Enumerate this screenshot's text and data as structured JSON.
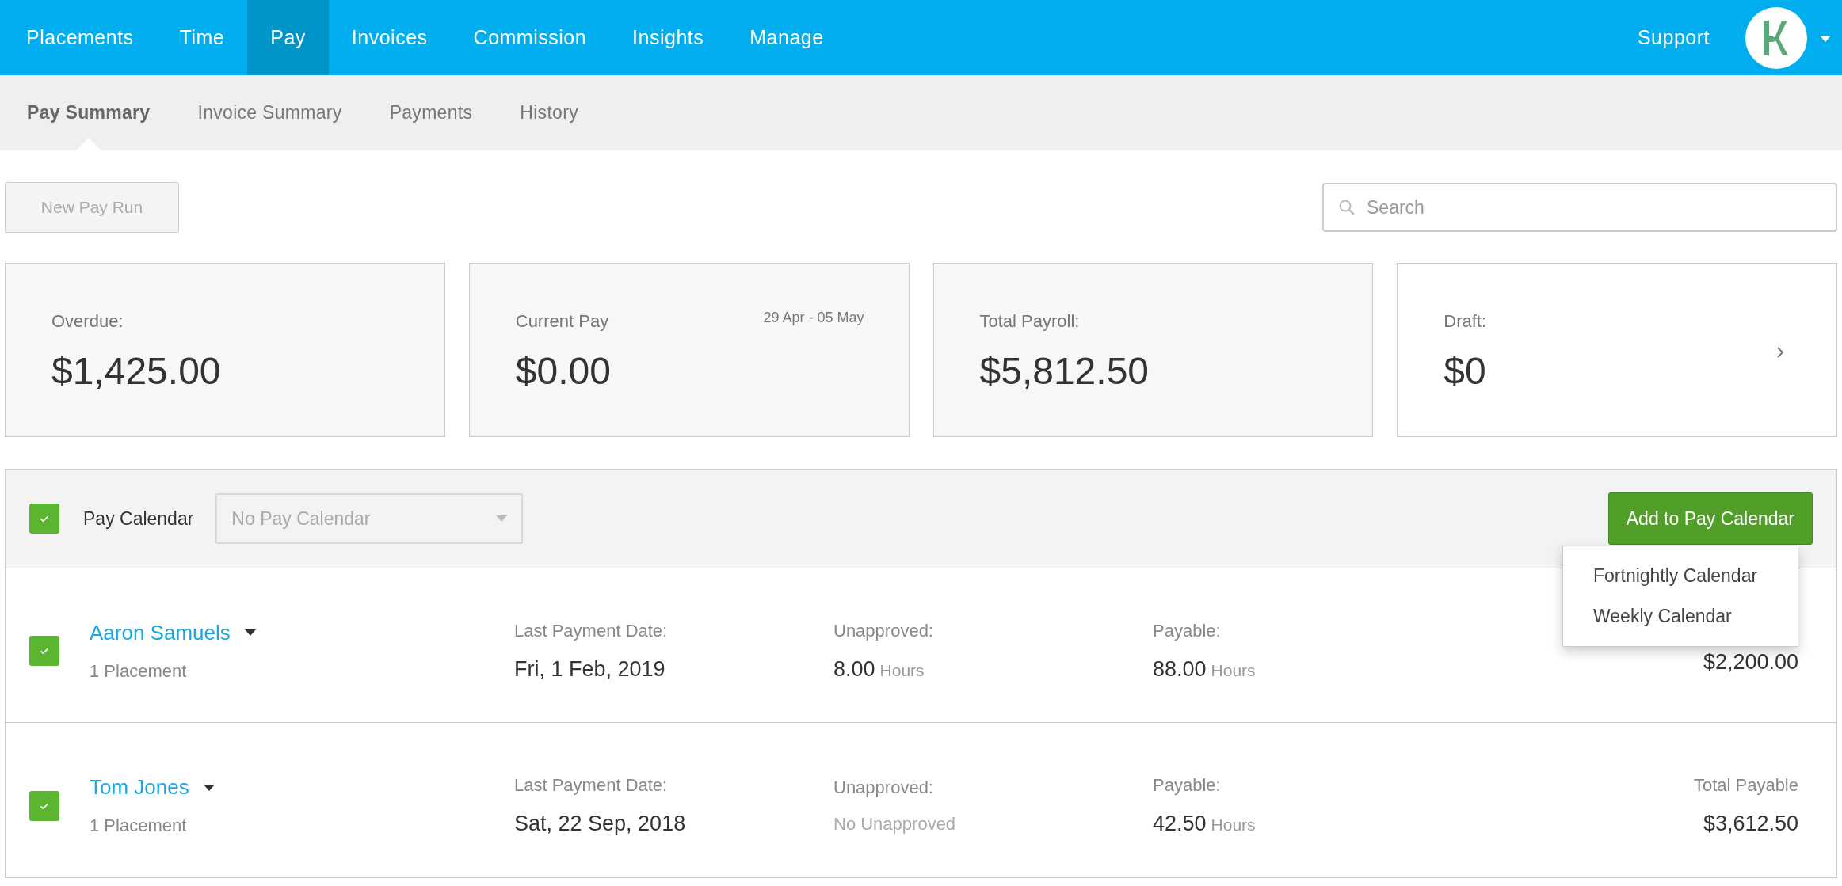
{
  "top_nav": {
    "items": [
      {
        "label": "Placements",
        "selected": false
      },
      {
        "label": "Time",
        "selected": false
      },
      {
        "label": "Pay",
        "selected": true
      },
      {
        "label": "Invoices",
        "selected": false
      },
      {
        "label": "Commission",
        "selected": false
      },
      {
        "label": "Insights",
        "selected": false
      },
      {
        "label": "Manage",
        "selected": false
      }
    ],
    "support": "Support"
  },
  "sub_nav": {
    "tabs": [
      {
        "label": "Pay Summary",
        "selected": true
      },
      {
        "label": "Invoice Summary",
        "selected": false
      },
      {
        "label": "Payments",
        "selected": false
      },
      {
        "label": "History",
        "selected": false
      }
    ]
  },
  "toolbar": {
    "new_pay_run": {
      "label": "New Pay Run",
      "disabled": true
    },
    "search": {
      "placeholder": "Search"
    }
  },
  "cards": [
    {
      "kind": "summary",
      "label": "Overdue:",
      "amount": "$1,425.00"
    },
    {
      "kind": "summary",
      "label": "Current Pay",
      "amount": "$0.00",
      "date_range": "29 Apr - 05 May"
    },
    {
      "kind": "summary",
      "label": "Total Payroll:",
      "amount": "$5,812.50"
    },
    {
      "kind": "link",
      "label": "Draft:",
      "amount": "$0"
    }
  ],
  "pay_panel": {
    "header": {
      "checked": true,
      "label": "Pay Calendar",
      "select": {
        "placeholder": "No Pay Calendar"
      },
      "button": "Add to Pay Calendar",
      "menu": [
        "Fortnightly Calendar",
        "Weekly Calendar"
      ]
    },
    "rows": [
      {
        "checked": true,
        "name": "Aaron Samuels",
        "placements": "1 Placement",
        "last_payment_label": "Last Payment Date:",
        "last_payment": "Fri, 1 Feb, 2019",
        "unapproved_label": "Unapproved:",
        "unapproved": {
          "value": "8.00",
          "unit": "Hours"
        },
        "payable_label": "Payable:",
        "payable": {
          "value": "88.00",
          "unit": "Hours"
        },
        "total": "$2,200.00"
      },
      {
        "checked": true,
        "name": "Tom Jones",
        "placements": "1 Placement",
        "last_payment_label": "Last Payment Date:",
        "last_payment": "Sat, 22 Sep, 2018",
        "unapproved_label": "Unapproved:",
        "unapproved": {
          "value": "No Unapproved"
        },
        "payable_label": "Payable:",
        "payable": {
          "value": "42.50",
          "unit": "Hours"
        },
        "total_label": "Total Payable",
        "total": "$3,612.50"
      }
    ]
  }
}
